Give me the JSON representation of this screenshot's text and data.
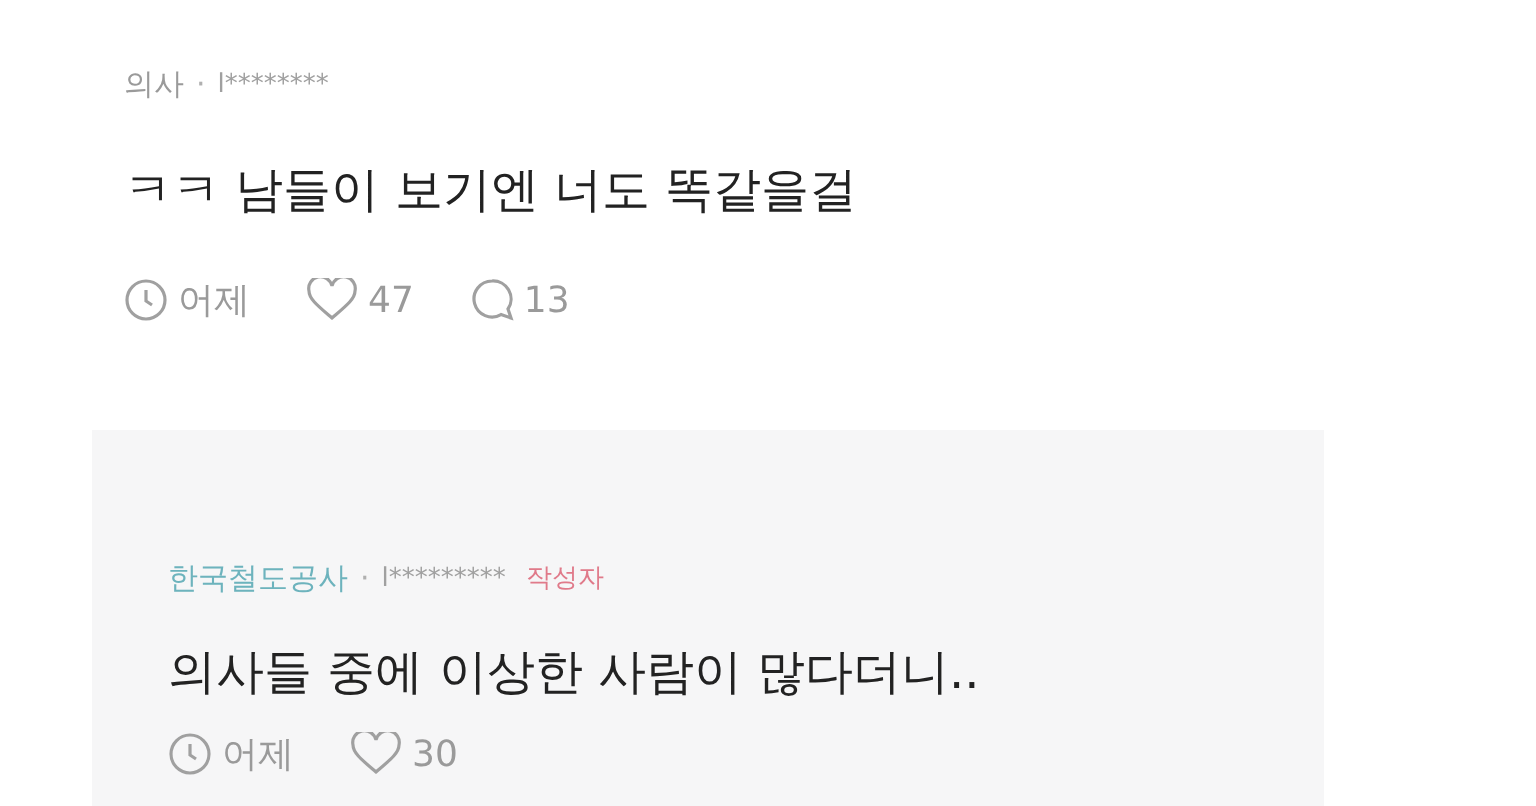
{
  "comments": [
    {
      "kind": "comment",
      "company": "의사",
      "separator": "·",
      "user": "l********",
      "text": "ㅋㅋ 남들이 보기엔 너도 똑같을걸",
      "time": "어제",
      "likes": "47",
      "replies": "13"
    },
    {
      "kind": "reply",
      "company": "한국철도공사",
      "separator": "·",
      "user": "l*********",
      "badge": "작성자",
      "text": "의사들 중에 이상한 사람이 많다더니..",
      "time": "어제",
      "likes": "30"
    }
  ]
}
